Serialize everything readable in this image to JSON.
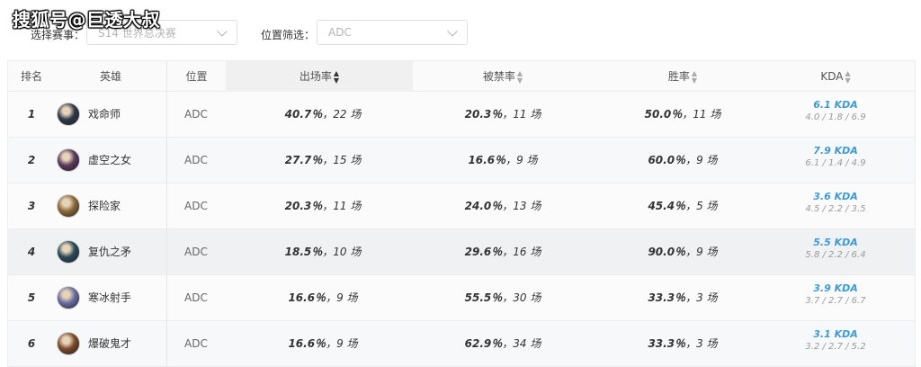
{
  "watermark": "搜狐号@巨透大叔",
  "filters": {
    "event_label": "选择赛事：",
    "event_value": "S14 世界总决赛",
    "position_label": "位置筛选：",
    "position_value": "ADC"
  },
  "table": {
    "headers": {
      "rank": "排名",
      "hero": "英雄",
      "position": "位置",
      "pick_rate": "出场率",
      "ban_rate": "被禁率",
      "win_rate": "胜率",
      "kda": "KDA"
    },
    "rows": [
      {
        "rank": "1",
        "hero": "戏命师",
        "position": "ADC",
        "pick_pct": "40.7％",
        "pick_games": "22 场",
        "ban_pct": "20.3％",
        "ban_games": "11 场",
        "win_pct": "50.0％",
        "win_games": "11 场",
        "kda": "6.1 KDA",
        "kda_detail": "4.0 / 1.8 / 6.9",
        "avatar_color": "#2f3a4a"
      },
      {
        "rank": "2",
        "hero": "虚空之女",
        "position": "ADC",
        "pick_pct": "27.7％",
        "pick_games": "15 场",
        "ban_pct": "16.6％",
        "ban_games": "9 场",
        "win_pct": "60.0％",
        "win_games": "9 场",
        "kda": "7.9 KDA",
        "kda_detail": "6.1 / 1.4 / 4.9",
        "avatar_color": "#5a3a5c"
      },
      {
        "rank": "3",
        "hero": "探险家",
        "position": "ADC",
        "pick_pct": "20.3％",
        "pick_games": "11 场",
        "ban_pct": "24.0％",
        "ban_games": "13 场",
        "win_pct": "45.4％",
        "win_games": "5 场",
        "kda": "3.6 KDA",
        "kda_detail": "4.5 / 2.2 / 3.5",
        "avatar_color": "#8a6a3a"
      },
      {
        "rank": "4",
        "hero": "复仇之矛",
        "position": "ADC",
        "pick_pct": "18.5％",
        "pick_games": "10 场",
        "ban_pct": "29.6％",
        "ban_games": "16 场",
        "win_pct": "90.0％",
        "win_games": "9 场",
        "kda": "5.5 KDA",
        "kda_detail": "5.8 / 2.2 / 6.4",
        "avatar_color": "#2a4a5a"
      },
      {
        "rank": "5",
        "hero": "寒冰射手",
        "position": "ADC",
        "pick_pct": "16.6％",
        "pick_games": "9 场",
        "ban_pct": "55.5％",
        "ban_games": "30 场",
        "win_pct": "33.3％",
        "win_games": "3 场",
        "kda": "3.9 KDA",
        "kda_detail": "3.7 / 2.7 / 6.7",
        "avatar_color": "#6a6fa0"
      },
      {
        "rank": "6",
        "hero": "爆破鬼才",
        "position": "ADC",
        "pick_pct": "16.6％",
        "pick_games": "9 场",
        "ban_pct": "62.9％",
        "ban_games": "34 场",
        "win_pct": "33.3％",
        "win_games": "3 场",
        "kda": "3.1 KDA",
        "kda_detail": "3.2 / 2.7 / 5.2",
        "avatar_color": "#7a4a2a"
      }
    ]
  },
  "colors": {
    "kda_accent": "#3d9ad6"
  }
}
